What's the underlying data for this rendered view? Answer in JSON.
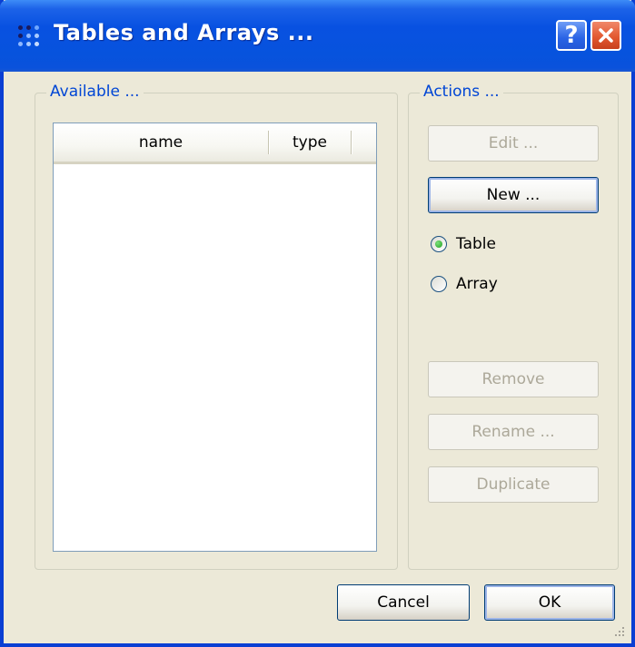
{
  "window": {
    "title": "Tables and Arrays ..."
  },
  "available": {
    "label": "Available ...",
    "columns": [
      "name",
      "type"
    ],
    "rows": []
  },
  "actions": {
    "label": "Actions ...",
    "edit_label": "Edit ...",
    "new_label": "New ...",
    "remove_label": "Remove",
    "rename_label": "Rename ...",
    "duplicate_label": "Duplicate",
    "type_options": [
      {
        "label": "Table",
        "selected": true
      },
      {
        "label": "Array",
        "selected": false
      }
    ]
  },
  "footer": {
    "cancel_label": "Cancel",
    "ok_label": "OK"
  },
  "colors": {
    "title_blue": "#0851e1",
    "group_label": "#0046d5",
    "dialog_bg": "#ece9d8"
  },
  "icons": {
    "app": "dots-app-icon",
    "help": "help-icon",
    "close": "close-icon",
    "grip": "resize-grip-icon"
  }
}
